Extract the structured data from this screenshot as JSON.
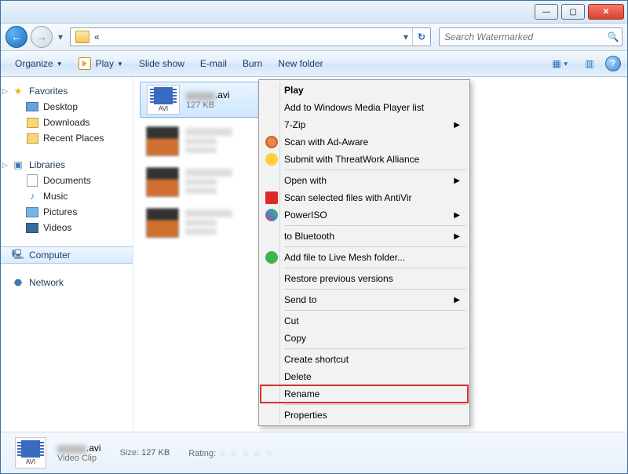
{
  "titlebar": {
    "min": "—",
    "max": "▢",
    "close": "✕"
  },
  "nav": {
    "back": "←",
    "fwd": "→",
    "crumb": "«",
    "search_placeholder": "Search Watermarked"
  },
  "toolbar": {
    "organize": "Organize",
    "play": "Play",
    "slideshow": "Slide show",
    "email": "E-mail",
    "burn": "Burn",
    "newfolder": "New folder"
  },
  "sidebar": {
    "favorites": {
      "label": "Favorites",
      "items": [
        {
          "label": "Desktop"
        },
        {
          "label": "Downloads"
        },
        {
          "label": "Recent Places"
        }
      ]
    },
    "libraries": {
      "label": "Libraries",
      "items": [
        {
          "label": "Documents"
        },
        {
          "label": "Music"
        },
        {
          "label": "Pictures"
        },
        {
          "label": "Videos"
        }
      ]
    },
    "computer": {
      "label": "Computer"
    },
    "network": {
      "label": "Network"
    }
  },
  "files": {
    "selected": {
      "name": ".avi",
      "size": "127 KB",
      "thumb_label": "AVI"
    }
  },
  "ctx": {
    "play": "Play",
    "wmp": "Add to Windows Media Player list",
    "zip": "7-Zip",
    "adaware": "Scan with Ad-Aware",
    "threatwork": "Submit with ThreatWork Alliance",
    "openwith": "Open with",
    "antivir": "Scan selected files with AntiVir",
    "poweriso": "PowerISO",
    "bluetooth": "to Bluetooth",
    "livemesh": "Add file to Live Mesh folder...",
    "restore": "Restore previous versions",
    "sendto": "Send to",
    "cut": "Cut",
    "copy": "Copy",
    "shortcut": "Create shortcut",
    "delete": "Delete",
    "rename": "Rename",
    "properties": "Properties"
  },
  "details": {
    "name": ".avi",
    "type": "Video Clip",
    "size_label": "Size:",
    "size": "127 KB",
    "rating_label": "Rating:",
    "stars": "☆ ☆ ☆ ☆ ☆"
  }
}
